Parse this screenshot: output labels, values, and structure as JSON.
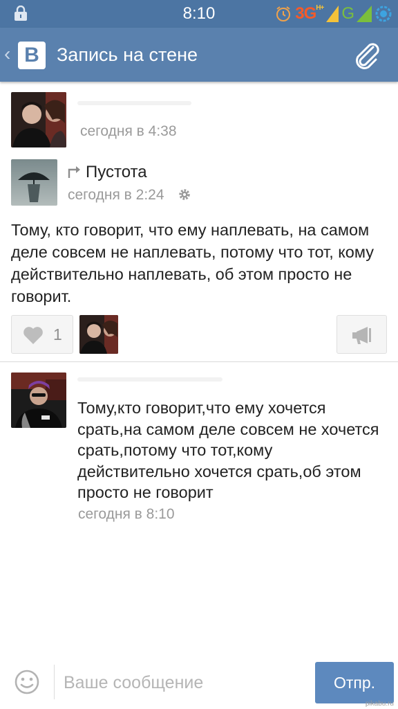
{
  "status_bar": {
    "time": "8:10",
    "network_3g": "3G",
    "network_3g_sup": "H+",
    "network_g": "G",
    "icons": [
      "lock-icon",
      "alarm-icon",
      "signal-icon",
      "battery-icon"
    ]
  },
  "header": {
    "back": "‹",
    "logo": "В",
    "title": "Запись на стене",
    "icons": [
      "back-chevron-icon",
      "vk-logo-icon",
      "paperclip-icon"
    ]
  },
  "post": {
    "author_time": "сегодня в 4:38",
    "repost": {
      "name": "Пустота",
      "time": "сегодня в 2:24",
      "icons": [
        "repost-arrow-icon",
        "settings-gear-icon"
      ]
    },
    "text": "Тому, кто говорит, что ему наплевать, на самом деле совсем не наплевать, потому что тот, кому действительно наплевать, об этом просто не говорит.",
    "likes": {
      "count": "1",
      "icon": "heart-icon"
    },
    "share_icon": "megaphone-icon"
  },
  "comment": {
    "text": "Тому,кто говорит,что ему хочется срать,на самом деле совсем не хочется срать,потому что тот,кому действительно хочется срать,об этом просто не говорит",
    "time": "сегодня в 8:10"
  },
  "composer": {
    "placeholder": "Ваше сообщение",
    "send_label": "Отпр.",
    "smile_icon": "smiley-icon"
  },
  "watermark": "pikabu.ru",
  "colors": {
    "status_bar": "#4c75a3",
    "header": "#5a81ae",
    "send_button": "#5d89be",
    "muted_text": "#9a9a9a"
  }
}
